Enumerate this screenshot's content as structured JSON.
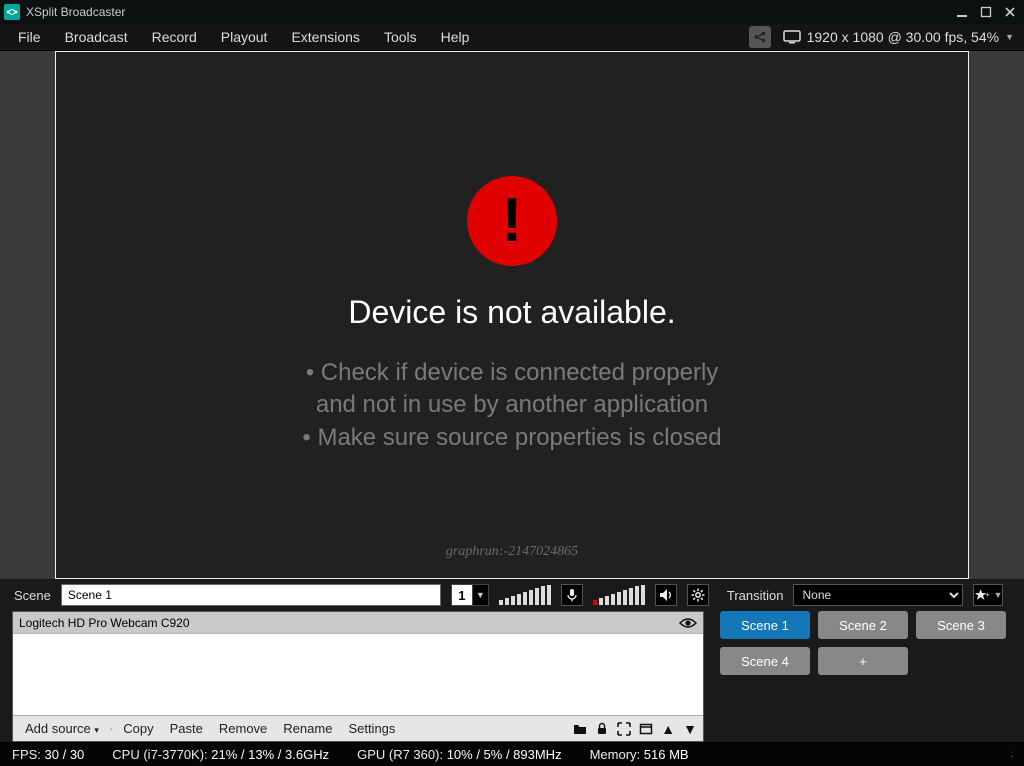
{
  "titlebar": {
    "title": "XSplit Broadcaster"
  },
  "menubar": {
    "items": [
      "File",
      "Broadcast",
      "Record",
      "Playout",
      "Extensions",
      "Tools",
      "Help"
    ],
    "resolution_text": "1920 x 1080 @ 30.00 fps, 54%"
  },
  "canvas": {
    "error_title": "Device is not available.",
    "hint1": "• Check if device is connected properly",
    "hint2": "and not in use by another application",
    "hint3": "• Make sure source properties is closed",
    "graphrun": "graphrun:-2147024865"
  },
  "controls": {
    "scene_label": "Scene",
    "scene_name": "Scene 1",
    "view_count": "1",
    "transition_label": "Transition",
    "transition_value": "None"
  },
  "sources": {
    "items": [
      {
        "label": "Logitech HD Pro Webcam C920"
      }
    ],
    "toolbar": {
      "add": "Add source",
      "copy": "Copy",
      "paste": "Paste",
      "remove": "Remove",
      "rename": "Rename",
      "settings": "Settings"
    }
  },
  "scenes": {
    "buttons": [
      "Scene 1",
      "Scene 2",
      "Scene 3",
      "Scene 4",
      "+"
    ],
    "active_index": 0
  },
  "status": {
    "fps_label": "FPS:",
    "fps_value": "30 / 30",
    "cpu_label": "CPU (i7-3770K):",
    "cpu_value": "21% / 13% / 3.6GHz",
    "gpu_label": "GPU (R7 360):",
    "gpu_value": "10% / 5% / 893MHz",
    "mem_label": "Memory:",
    "mem_value": "516 MB"
  }
}
